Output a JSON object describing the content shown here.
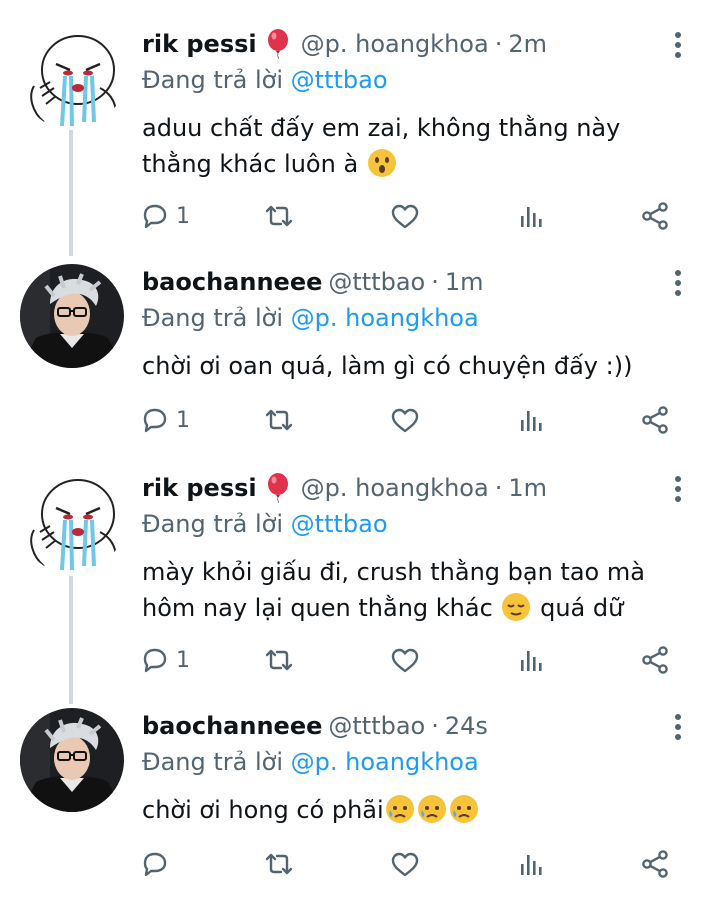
{
  "tweets": [
    {
      "name": "rik pessi",
      "badge_icon": "balloon-icon",
      "handle": "@p. hoangkhoa",
      "time": "2m",
      "reply_prefix": "Đang trả lời",
      "reply_to": "@tttbao",
      "text_line1": "aduu chất đấy em zai, không thằng này",
      "text_line2": "thằng khác luôn à",
      "reply_count": "1"
    },
    {
      "name": "baochanneee",
      "handle": "@tttbao",
      "time": "1m",
      "reply_prefix": "Đang trả lời",
      "reply_to": "@p. hoangkhoa",
      "text_line1": "chời ơi oan quá, làm gì có chuyện đấy :))",
      "reply_count": "1"
    },
    {
      "name": "rik pessi",
      "badge_icon": "balloon-icon",
      "handle": "@p. hoangkhoa",
      "time": "1m",
      "reply_prefix": "Đang trả lời",
      "reply_to": "@tttbao",
      "text_line1": "mày khỏi giấu đi, crush thằng bạn tao mà",
      "text_line2_a": "hôm nay lại quen thằng khác",
      "text_line2_b": "quá dữ",
      "reply_count": "1"
    },
    {
      "name": "baochanneee",
      "handle": "@tttbao",
      "time": "24s",
      "reply_prefix": "Đang trả lời",
      "reply_to": "@p. hoangkhoa",
      "text_line1": "chời ơi hong có phãi",
      "reply_count": ""
    }
  ],
  "colors": {
    "mention": "#1d9bf0",
    "muted": "#536471",
    "thread_line": "#cfd9de"
  }
}
